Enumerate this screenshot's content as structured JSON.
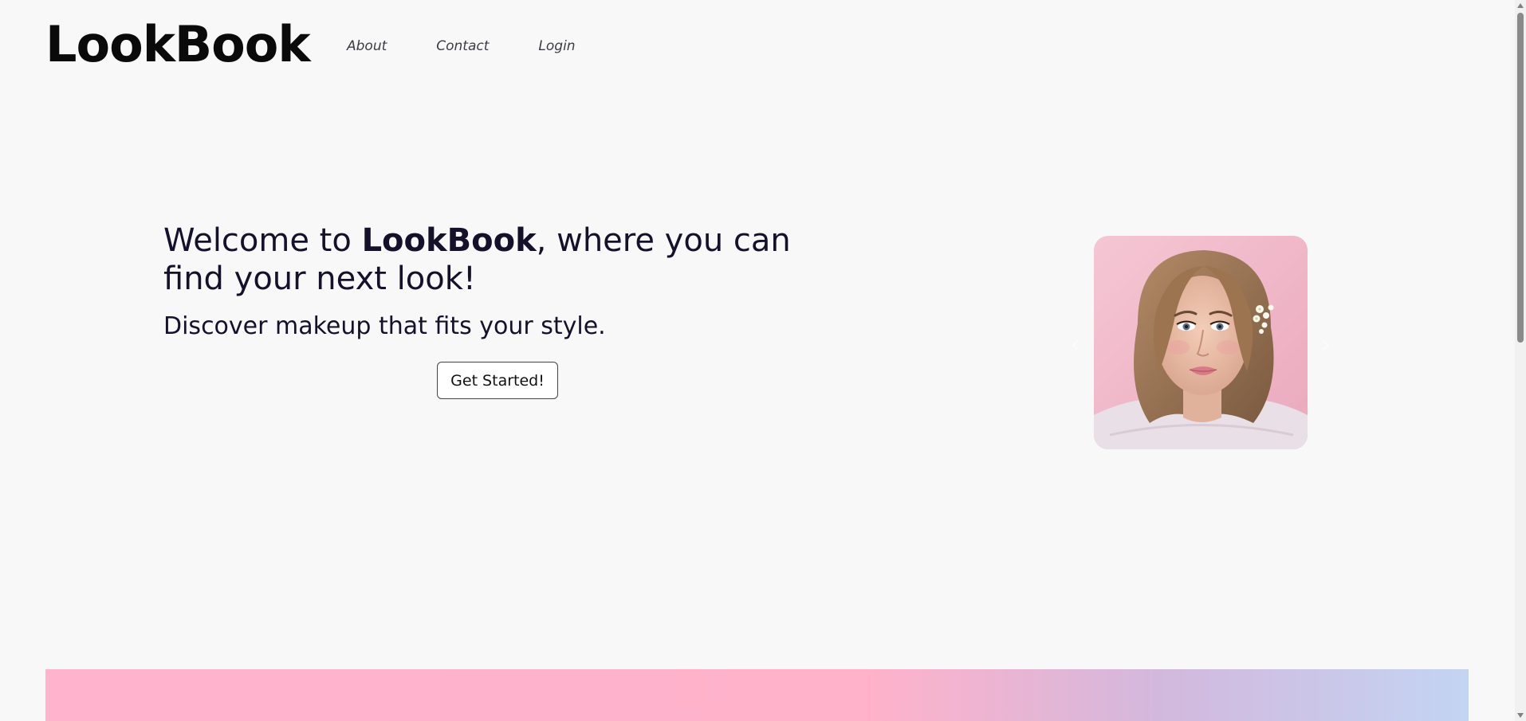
{
  "header": {
    "logo": "LookBook",
    "nav": [
      "About",
      "Contact",
      "Login"
    ]
  },
  "hero": {
    "title_before": "Welcome to ",
    "title_brand": "LookBook",
    "title_after": ", where you can find your next look!",
    "subtitle": "Discover makeup that fits your style.",
    "cta_label": "Get Started!"
  },
  "carousel": {
    "prev_icon": "chevron-left-icon",
    "next_icon": "chevron-right-icon"
  },
  "colors": {
    "background": "#f8f8f9",
    "text": "#15112a",
    "gradient_start": "#ffb3cd",
    "gradient_end": "#c3d4f3"
  }
}
